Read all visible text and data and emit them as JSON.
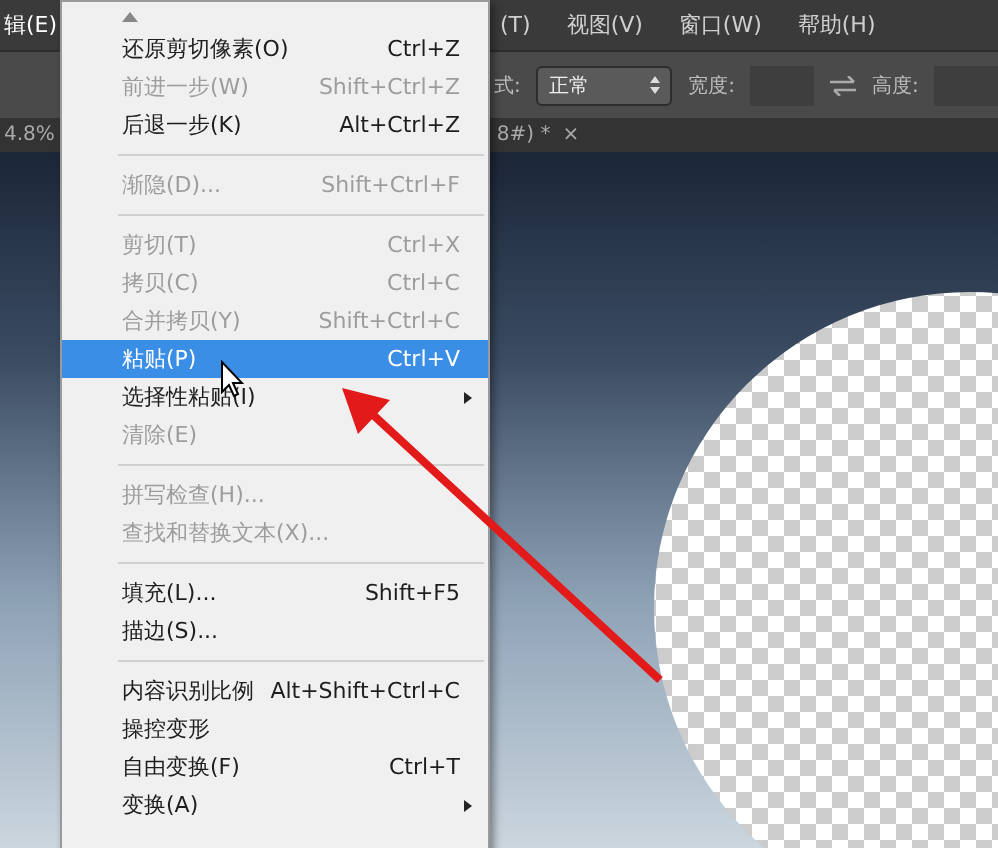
{
  "menubar": [
    {
      "label": "辑(E)",
      "selected": true
    },
    {
      "label": "(T)",
      "selected": false
    },
    {
      "label": "视图(V)",
      "selected": false
    },
    {
      "label": "窗口(W)",
      "selected": false
    },
    {
      "label": "帮助(H)",
      "selected": false
    }
  ],
  "options_bar": {
    "mode_label": "式:",
    "mode_value": "正常",
    "width_label": "宽度:",
    "height_label": "高度:"
  },
  "document": {
    "zoom": "4.8%",
    "tab_title": "8#) *",
    "close": "×"
  },
  "edit_menu": [
    {
      "kind": "scroll"
    },
    {
      "kind": "item",
      "label": "还原剪切像素(O)",
      "shortcut": "Ctrl+Z",
      "disabled": false,
      "selected": false,
      "submenu": false
    },
    {
      "kind": "item",
      "label": "前进一步(W)",
      "shortcut": "Shift+Ctrl+Z",
      "disabled": true,
      "selected": false,
      "submenu": false
    },
    {
      "kind": "item",
      "label": "后退一步(K)",
      "shortcut": "Alt+Ctrl+Z",
      "disabled": false,
      "selected": false,
      "submenu": false
    },
    {
      "kind": "separator"
    },
    {
      "kind": "item",
      "label": "渐隐(D)...",
      "shortcut": "Shift+Ctrl+F",
      "disabled": true,
      "selected": false,
      "submenu": false
    },
    {
      "kind": "separator"
    },
    {
      "kind": "item",
      "label": "剪切(T)",
      "shortcut": "Ctrl+X",
      "disabled": true,
      "selected": false,
      "submenu": false
    },
    {
      "kind": "item",
      "label": "拷贝(C)",
      "shortcut": "Ctrl+C",
      "disabled": true,
      "selected": false,
      "submenu": false
    },
    {
      "kind": "item",
      "label": "合并拷贝(Y)",
      "shortcut": "Shift+Ctrl+C",
      "disabled": true,
      "selected": false,
      "submenu": false
    },
    {
      "kind": "item",
      "label": "粘贴(P)",
      "shortcut": "Ctrl+V",
      "disabled": false,
      "selected": true,
      "submenu": false
    },
    {
      "kind": "item",
      "label": "选择性粘贴(I)",
      "disabled": false,
      "selected": false,
      "submenu": true
    },
    {
      "kind": "item",
      "label": "清除(E)",
      "disabled": true,
      "selected": false,
      "submenu": false
    },
    {
      "kind": "separator"
    },
    {
      "kind": "item",
      "label": "拼写检查(H)...",
      "disabled": true,
      "selected": false,
      "submenu": false
    },
    {
      "kind": "item",
      "label": "查找和替换文本(X)...",
      "disabled": true,
      "selected": false,
      "submenu": false
    },
    {
      "kind": "separator"
    },
    {
      "kind": "item",
      "label": "填充(L)...",
      "shortcut": "Shift+F5",
      "disabled": false,
      "selected": false,
      "submenu": false
    },
    {
      "kind": "item",
      "label": "描边(S)...",
      "disabled": false,
      "selected": false,
      "submenu": false
    },
    {
      "kind": "separator"
    },
    {
      "kind": "item",
      "label": "内容识别比例",
      "shortcut": "Alt+Shift+Ctrl+C",
      "disabled": false,
      "selected": false,
      "submenu": false
    },
    {
      "kind": "item",
      "label": "操控变形",
      "disabled": false,
      "selected": false,
      "submenu": false
    },
    {
      "kind": "item",
      "label": "自由变换(F)",
      "shortcut": "Ctrl+T",
      "disabled": false,
      "selected": false,
      "submenu": false
    },
    {
      "kind": "item",
      "label": "变换(A)",
      "disabled": false,
      "selected": false,
      "submenu": true
    }
  ]
}
